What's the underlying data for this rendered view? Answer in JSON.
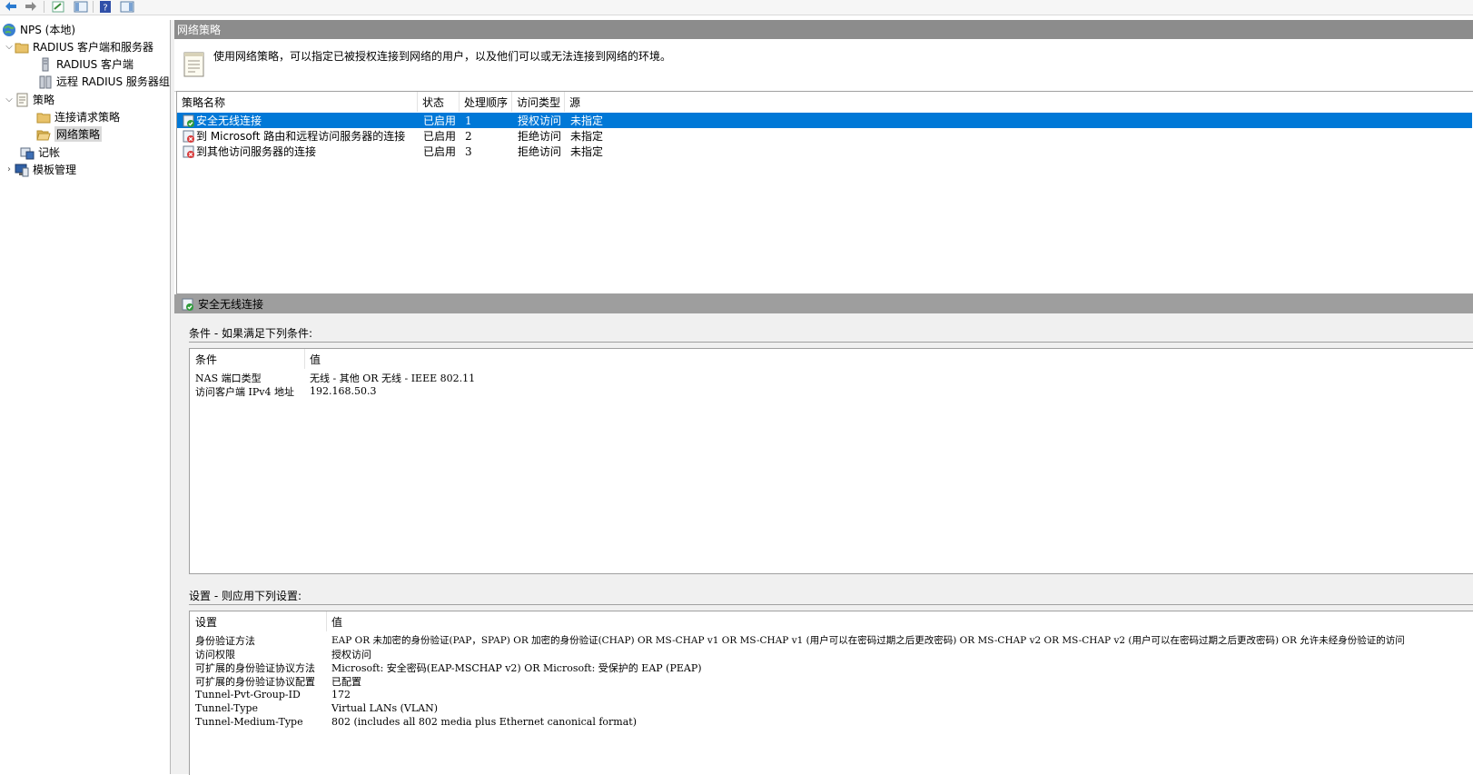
{
  "toolbar": {
    "buttons": [
      "back-icon",
      "forward-icon",
      "console-tree-icon",
      "properties-icon",
      "help-icon",
      "action-pane-icon"
    ]
  },
  "tree": {
    "root": "NPS (本地)",
    "radius_group": "RADIUS 客户端和服务器",
    "radius_clients": "RADIUS 客户端",
    "remote_radius": "远程 RADIUS 服务器组",
    "policies": "策略",
    "connection_request": "连接请求策略",
    "network_policies": "网络策略",
    "accounting": "记帐",
    "templates": "模板管理"
  },
  "panel": {
    "title": "网络策略",
    "description": "使用网络策略，可以指定已被授权连接到网络的用户，以及他们可以或无法连接到网络的环境。"
  },
  "policy_table": {
    "columns": [
      "策略名称",
      "状态",
      "处理顺序",
      "访问类型",
      "源"
    ],
    "rows": [
      {
        "name": "安全无线连接",
        "status": "已启用",
        "order": "1",
        "access": "授权访问",
        "source": "未指定",
        "icon": "policy-allow-icon",
        "selected": true
      },
      {
        "name": "到 Microsoft 路由和远程访问服务器的连接",
        "status": "已启用",
        "order": "2",
        "access": "拒绝访问",
        "source": "未指定",
        "icon": "policy-deny-icon",
        "selected": false
      },
      {
        "name": "到其他访问服务器的连接",
        "status": "已启用",
        "order": "3",
        "access": "拒绝访问",
        "source": "未指定",
        "icon": "policy-deny-icon",
        "selected": false
      }
    ]
  },
  "detail": {
    "title": "安全无线连接",
    "conditions_label": "条件 - 如果满足下列条件:",
    "conditions_columns": [
      "条件",
      "值"
    ],
    "conditions": [
      {
        "key": "NAS 端口类型",
        "value": "无线 - 其他 OR 无线 - IEEE 802.11"
      },
      {
        "key": "访问客户端 IPv4 地址",
        "value": "192.168.50.3"
      }
    ],
    "settings_label": "设置 - 则应用下列设置:",
    "settings_columns": [
      "设置",
      "值"
    ],
    "settings": [
      {
        "key": "身份验证方法",
        "value": "EAP OR 未加密的身份验证(PAP，SPAP) OR 加密的身份验证(CHAP) OR MS-CHAP v1 OR MS-CHAP v1 (用户可以在密码过期之后更改密码) OR MS-CHAP v2 OR MS-CHAP v2 (用户可以在密码过期之后更改密码) OR 允许未经身份验证的访问"
      },
      {
        "key": "访问权限",
        "value": "授权访问"
      },
      {
        "key": "可扩展的身份验证协议方法",
        "value": "Microsoft: 安全密码(EAP-MSCHAP v2) OR Microsoft: 受保护的 EAP (PEAP)"
      },
      {
        "key": "可扩展的身份验证协议配置",
        "value": "已配置"
      },
      {
        "key": "Tunnel-Pvt-Group-ID",
        "value": "172"
      },
      {
        "key": "Tunnel-Type",
        "value": "Virtual LANs (VLAN)"
      },
      {
        "key": "Tunnel-Medium-Type",
        "value": "802 (includes all 802 media plus Ethernet canonical format)"
      }
    ]
  },
  "colors": {
    "selection": "#0078d7",
    "title_bar": "#8c8c8c",
    "detail_bar": "#9e9e9e",
    "detail_bg": "#f0f0f0",
    "allow_green": "#2e9b3a",
    "deny_red": "#d83b3b"
  }
}
